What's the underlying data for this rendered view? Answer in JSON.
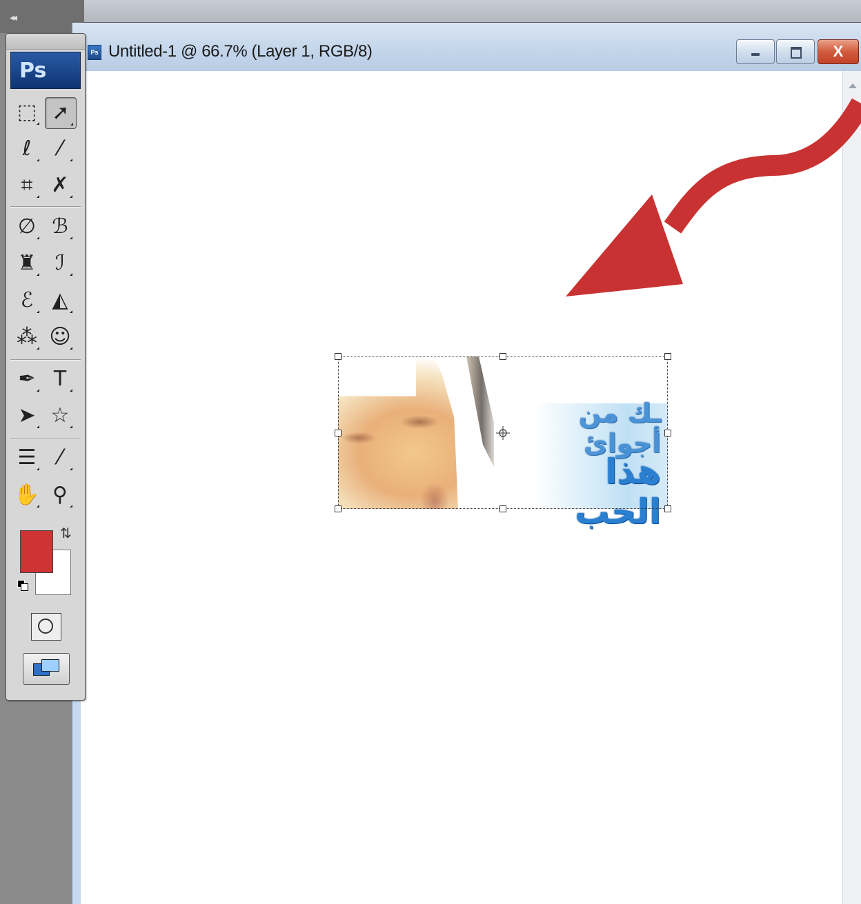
{
  "app": {
    "logo_text": "Ps",
    "collapse_glyph": "◂◂"
  },
  "document": {
    "title": "Untitled-1 @ 66.7% (Layer 1, RGB/8)",
    "icon_text": "Ps",
    "window_buttons": [
      "minimize",
      "maximize",
      "close"
    ],
    "close_glyph": "X"
  },
  "canvas": {
    "placed_image": {
      "arabic_line1": "ـك من أجوائ",
      "arabic_line2": "هذا الحب"
    },
    "annotation_arrow_color": "#c93232"
  },
  "toolbox": {
    "tools": [
      {
        "name": "marquee-tool-icon",
        "glyph": "⬚"
      },
      {
        "name": "move-tool-icon",
        "glyph": "➚"
      },
      {
        "name": "lasso-tool-icon",
        "glyph": "ℓ"
      },
      {
        "name": "magic-wand-tool-icon",
        "glyph": "⁄"
      },
      {
        "name": "crop-tool-icon",
        "glyph": "⌗"
      },
      {
        "name": "slice-tool-icon",
        "glyph": "✗"
      },
      {
        "name": "healing-brush-tool-icon",
        "glyph": "∅"
      },
      {
        "name": "brush-tool-icon",
        "glyph": "ℬ"
      },
      {
        "name": "stamp-tool-icon",
        "glyph": "♜"
      },
      {
        "name": "history-brush-tool-icon",
        "glyph": "ℐ"
      },
      {
        "name": "eraser-tool-icon",
        "glyph": "ℰ"
      },
      {
        "name": "paint-bucket-tool-icon",
        "glyph": "◭"
      },
      {
        "name": "blur-tool-icon",
        "glyph": "⁂"
      },
      {
        "name": "dodge-tool-icon",
        "glyph": "☺"
      },
      {
        "name": "pen-tool-icon",
        "glyph": "✒"
      },
      {
        "name": "type-tool-icon",
        "glyph": "T"
      },
      {
        "name": "path-selection-tool-icon",
        "glyph": "➤"
      },
      {
        "name": "custom-shape-tool-icon",
        "glyph": "☆"
      },
      {
        "name": "notes-tool-icon",
        "glyph": "☰"
      },
      {
        "name": "eyedropper-tool-icon",
        "glyph": "⁄"
      },
      {
        "name": "hand-tool-icon",
        "glyph": "✋"
      },
      {
        "name": "zoom-tool-icon",
        "glyph": "⚲"
      }
    ],
    "foreground_color": "#cf3333",
    "background_color": "#ffffff",
    "swap_glyph": "⇅"
  }
}
